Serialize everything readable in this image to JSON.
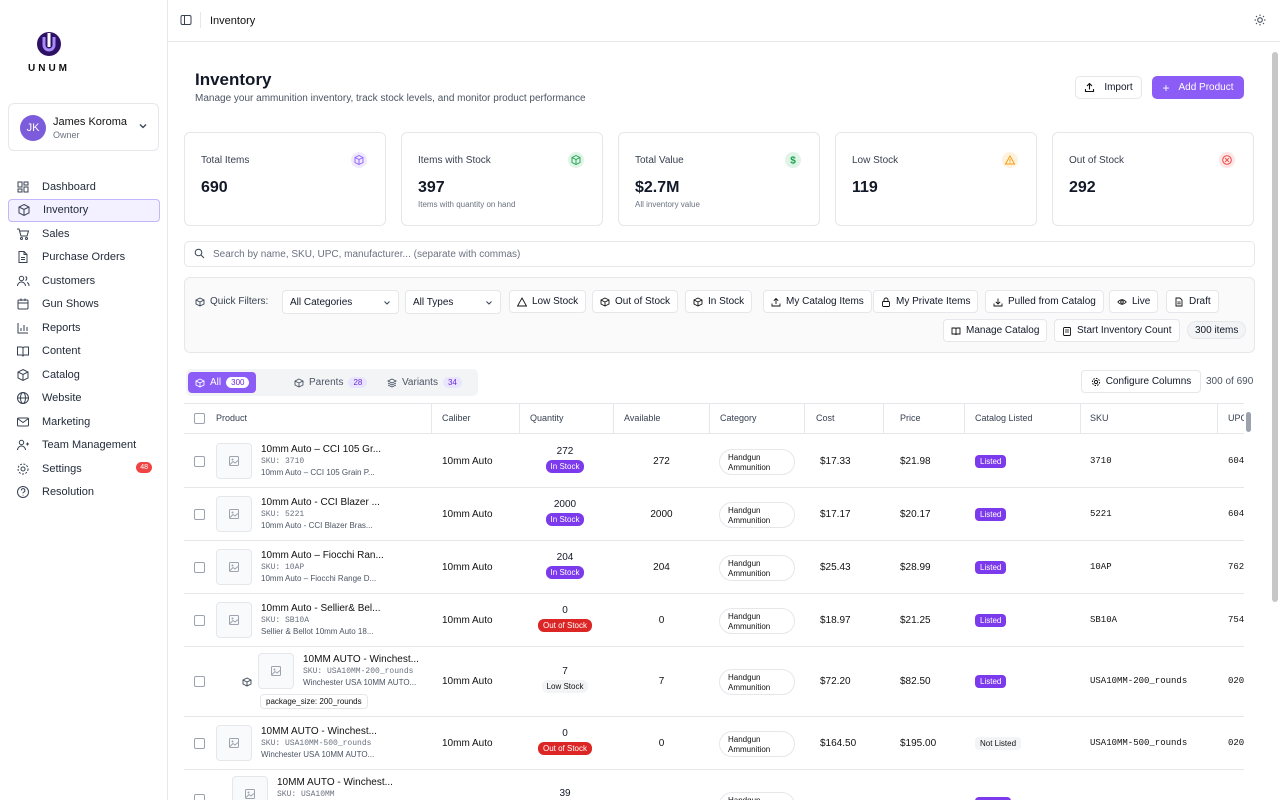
{
  "brand": {
    "name": "UNUM",
    "accent": "#8b5cf6"
  },
  "user": {
    "initials": "JK",
    "name": "James Koroma",
    "role": "Owner"
  },
  "nav": [
    {
      "label": "Dashboard",
      "icon": "dashboard-icon"
    },
    {
      "label": "Inventory",
      "icon": "box-icon",
      "active": true
    },
    {
      "label": "Sales",
      "icon": "cart-icon"
    },
    {
      "label": "Purchase Orders",
      "icon": "document-icon"
    },
    {
      "label": "Customers",
      "icon": "users-icon"
    },
    {
      "label": "Gun Shows",
      "icon": "calendar-icon"
    },
    {
      "label": "Reports",
      "icon": "chart-icon"
    },
    {
      "label": "Content",
      "icon": "book-icon"
    },
    {
      "label": "Catalog",
      "icon": "box-icon"
    },
    {
      "label": "Website",
      "icon": "globe-icon"
    },
    {
      "label": "Marketing",
      "icon": "mail-icon"
    },
    {
      "label": "Team Management",
      "icon": "team-icon"
    },
    {
      "label": "Settings",
      "icon": "gear-icon",
      "badge": "48"
    },
    {
      "label": "Resolution",
      "icon": "help-icon"
    }
  ],
  "topbar": {
    "title": "Inventory"
  },
  "page": {
    "title": "Inventory",
    "subtitle": "Manage your ammunition inventory, track stock levels, and monitor product performance",
    "import_label": "Import",
    "add_label": "Add Product"
  },
  "stats": [
    {
      "label": "Total Items",
      "value": "690",
      "hint": "",
      "color": "#8b5cf6"
    },
    {
      "label": "Items with Stock",
      "value": "397",
      "hint": "Items with quantity on hand",
      "color": "#16a34a"
    },
    {
      "label": "Total Value",
      "value": "$2.7M",
      "hint": "All inventory value",
      "color": "#16a34a"
    },
    {
      "label": "Low Stock",
      "value": "119",
      "hint": "",
      "color": "#f59e0b"
    },
    {
      "label": "Out of Stock",
      "value": "292",
      "hint": "",
      "color": "#ef4444"
    }
  ],
  "search": {
    "placeholder": "Search by name, SKU, UPC, manufacturer... (separate with commas)"
  },
  "filters": {
    "label": "Quick Filters:",
    "categories": "All Categories",
    "types": "All Types",
    "buttons": [
      "Low Stock",
      "Out of Stock",
      "In Stock",
      "My Catalog Items",
      "My Private Items",
      "Pulled from Catalog",
      "Live",
      "Draft"
    ],
    "manage_catalog": "Manage Catalog",
    "start_count": "Start Inventory Count",
    "item_count": "300 items"
  },
  "tabs": [
    {
      "label": "All",
      "count": "300"
    },
    {
      "label": "Parents",
      "count": "28"
    },
    {
      "label": "Variants",
      "count": "34"
    }
  ],
  "configure_label": "Configure  Columns",
  "showing": "300 of 690",
  "columns": [
    "Product",
    "Caliber",
    "Quantity",
    "Available",
    "Category",
    "Cost",
    "Price",
    "Catalog Listed",
    "SKU",
    "UPC"
  ],
  "rows": [
    {
      "name": "10mm Auto – CCI 105 Gr...",
      "sku": "SKU: 3710",
      "desc": "10mm Auto – CCI 105 Grain P...",
      "caliber": "10mm Auto",
      "qty": "272",
      "status": "In Stock",
      "available": "272",
      "category": "Handgun Ammunition",
      "cost": "$17.33",
      "price": "$21.98",
      "listed": "Listed",
      "sku_code": "3710",
      "upc": "604"
    },
    {
      "name": "10mm Auto - CCI Blazer ...",
      "sku": "SKU: 5221",
      "desc": "10mm Auto - CCI Blazer Bras...",
      "caliber": "10mm Auto",
      "qty": "2000",
      "status": "In Stock",
      "available": "2000",
      "category": "Handgun Ammunition",
      "cost": "$17.17",
      "price": "$20.17",
      "listed": "Listed",
      "sku_code": "5221",
      "upc": "604"
    },
    {
      "name": "10mm Auto – Fiocchi Ran...",
      "sku": "SKU: 10AP",
      "desc": "10mm Auto – Fiocchi Range D...",
      "caliber": "10mm Auto",
      "qty": "204",
      "status": "In Stock",
      "available": "204",
      "category": "Handgun Ammunition",
      "cost": "$25.43",
      "price": "$28.99",
      "listed": "Listed",
      "sku_code": "10AP",
      "upc": "762"
    },
    {
      "name": "10mm Auto - Sellier& Bel...",
      "sku": "SKU: SB10A",
      "desc": "Sellier & Bellot 10mm Auto 18...",
      "caliber": "10mm Auto",
      "qty": "0",
      "status": "Out of Stock",
      "available": "0",
      "category": "Handgun Ammunition",
      "cost": "$18.97",
      "price": "$21.25",
      "listed": "Listed",
      "sku_code": "SB10A",
      "upc": "754"
    },
    {
      "name": "10MM AUTO - Winchest...",
      "sku": "SKU: USA10MM-200_rounds",
      "desc": "Winchester USA 10MM AUTO...",
      "tag": "package_size: 200_rounds",
      "caliber": "10mm Auto",
      "qty": "7",
      "status": "Low Stock",
      "available": "7",
      "category": "Handgun Ammunition",
      "cost": "$72.20",
      "price": "$82.50",
      "listed": "Listed",
      "sku_code": "USA10MM-200_rounds",
      "upc": "020"
    },
    {
      "name": "10MM AUTO - Winchest...",
      "sku": "SKU: USA10MM-500_rounds",
      "desc": "Winchester USA 10MM AUTO...",
      "caliber": "10mm Auto",
      "qty": "0",
      "status": "Out of Stock",
      "available": "0",
      "category": "Handgun Ammunition",
      "cost": "$164.50",
      "price": "$195.00",
      "listed": "Not Listed",
      "sku_code": "USA10MM-500_rounds",
      "upc": "020"
    },
    {
      "name": "10MM AUTO - Winchest...",
      "sku": "SKU: USA10MM",
      "desc": "",
      "caliber": "",
      "qty": "39",
      "status": "",
      "available": "",
      "category": "Handgun",
      "cost": "",
      "price": "",
      "listed": "",
      "sku_code": "",
      "upc": ""
    }
  ]
}
